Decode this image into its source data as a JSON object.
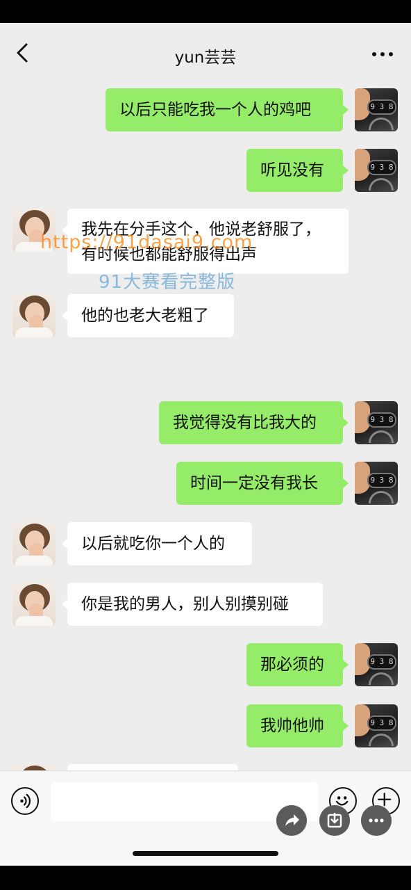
{
  "header": {
    "title": "yun芸芸"
  },
  "messages": [
    {
      "side": "right",
      "text": "以后只能吃我一个人的鸡吧"
    },
    {
      "side": "right",
      "text": "听见没有"
    },
    {
      "side": "left",
      "line1": "我先在分手这个，他说老舒服了，",
      "line2": "有时候也都能舒服得出声"
    },
    {
      "side": "left",
      "text": "他的也老大老粗了"
    },
    {
      "side": "right",
      "text": "我觉得没有比我大的"
    },
    {
      "side": "right",
      "text": "时间一定没有我长"
    },
    {
      "side": "left",
      "text": "以后就吃你一个人的"
    },
    {
      "side": "left",
      "text": "你是我的男人，别人别摸别碰"
    },
    {
      "side": "right",
      "text": "那必须的"
    },
    {
      "side": "right",
      "text": "我帅他帅"
    }
  ],
  "watermark": {
    "line1": "https://91dasai9.com",
    "line2": "91大赛看完整版"
  },
  "avatar": {
    "dial_text": "9 3 8"
  },
  "icons": [
    "back-icon",
    "more-icon",
    "voice-icon",
    "emoji-icon",
    "plus-icon",
    "share-icon",
    "download-icon",
    "more-options-icon"
  ],
  "colors": {
    "background": "#ededed",
    "bubble_self": "#95ec69",
    "bubble_other": "#ffffff",
    "watermark_orange": "#f68c1e",
    "watermark_blue": "#78afd7"
  }
}
